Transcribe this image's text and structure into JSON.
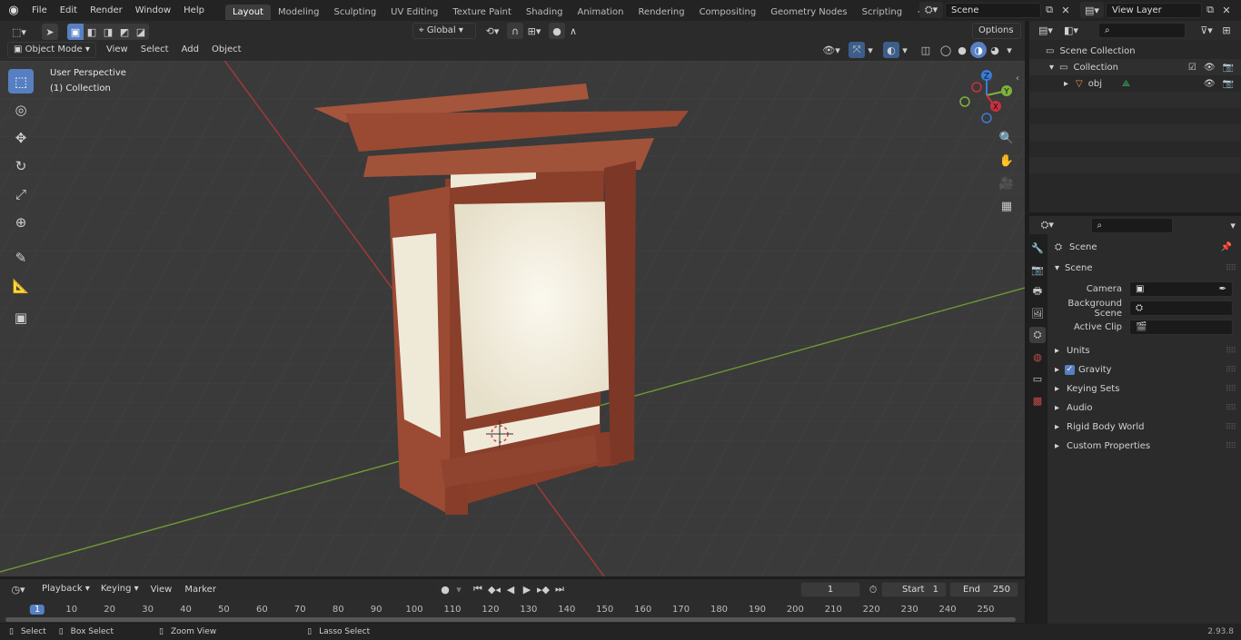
{
  "app": {
    "version": "2.93.8"
  },
  "topbar": {
    "menus": [
      "File",
      "Edit",
      "Render",
      "Window",
      "Help"
    ],
    "workspaces": [
      "Layout",
      "Modeling",
      "Sculpting",
      "UV Editing",
      "Texture Paint",
      "Shading",
      "Animation",
      "Rendering",
      "Compositing",
      "Geometry Nodes",
      "Scripting"
    ],
    "active_workspace": "Layout",
    "add_workspace": "+",
    "scene": "Scene",
    "view_layer": "View Layer"
  },
  "viewport_header": {
    "mode": "Object Mode",
    "menus": [
      "View",
      "Select",
      "Add",
      "Object"
    ],
    "transform_orientation": "Global",
    "options": "Options"
  },
  "viewport": {
    "perspective_label": "User Perspective",
    "collection_label": "(1) Collection",
    "gizmo": {
      "z": "Z",
      "y": "Y",
      "x": "X"
    }
  },
  "toolbar": {
    "tools": [
      {
        "name": "select-box-tool",
        "glyph": "⬚",
        "active": true
      },
      {
        "name": "cursor-tool",
        "glyph": "◎",
        "active": false
      },
      {
        "name": "move-tool",
        "glyph": "✥",
        "active": false
      },
      {
        "name": "rotate-tool",
        "glyph": "↻",
        "active": false
      },
      {
        "name": "scale-tool",
        "glyph": "⤢",
        "active": false
      },
      {
        "name": "transform-tool",
        "glyph": "⊕",
        "active": false
      },
      {
        "name": "annotate-tool",
        "glyph": "✎",
        "active": false
      },
      {
        "name": "measure-tool",
        "glyph": "📐",
        "active": false
      },
      {
        "name": "add-cube-tool",
        "glyph": "▣",
        "active": false
      }
    ]
  },
  "outliner": {
    "scene_collection": "Scene Collection",
    "collection": "Collection",
    "object": "obj"
  },
  "properties": {
    "context": "Scene",
    "panel_title": "Scene",
    "fields": [
      {
        "label": "Camera",
        "value": ""
      },
      {
        "label": "Background Scene",
        "value": ""
      },
      {
        "label": "Active Clip",
        "value": ""
      }
    ],
    "subpanels": [
      "Units",
      "Gravity",
      "Keying Sets",
      "Audio",
      "Rigid Body World",
      "Custom Properties"
    ],
    "gravity_checked": true
  },
  "timeline": {
    "menus": [
      "Playback",
      "Keying",
      "View",
      "Marker"
    ],
    "current_frame": "1",
    "start_label": "Start",
    "start_value": "1",
    "end_label": "End",
    "end_value": "250",
    "ticks": [
      "1",
      "10",
      "20",
      "30",
      "40",
      "50",
      "60",
      "70",
      "80",
      "90",
      "100",
      "110",
      "120",
      "130",
      "140",
      "150",
      "160",
      "170",
      "180",
      "190",
      "200",
      "210",
      "220",
      "230",
      "240",
      "250"
    ]
  },
  "statusbar": {
    "items": [
      "Select",
      "Box Select",
      "Zoom View",
      "Lasso Select"
    ]
  },
  "colors": {
    "accent": "#5680c2",
    "viewport_bg": "#3b3b3b",
    "wood": "#9a4a33",
    "paper": "#efe9d8",
    "x_axis": "#c9313d",
    "y_axis": "#7db33c",
    "z_axis": "#3a7cd8"
  }
}
